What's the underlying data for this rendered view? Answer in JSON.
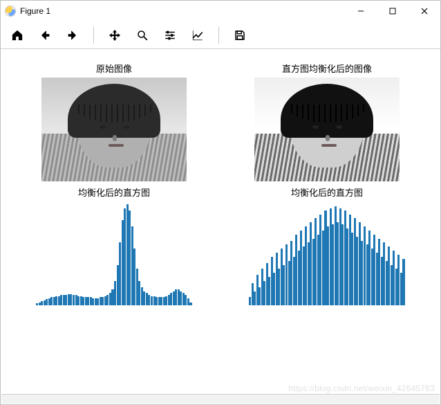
{
  "window": {
    "title": "Figure 1"
  },
  "toolbar": {
    "home": "Home",
    "back": "Back",
    "forward": "Forward",
    "pan": "Pan",
    "zoom": "Zoom",
    "configure": "Configure subplots",
    "edit": "Edit axis",
    "save": "Save"
  },
  "subplots": {
    "tl_title": "原始图像",
    "tr_title": "直方图均衡化后的图像",
    "bl_title": "均衡化后的直方图",
    "br_title": "均衡化后的直方图"
  },
  "chart_data": [
    {
      "type": "bar",
      "title": "均衡化后的直方图",
      "xlabel": "",
      "ylabel": "",
      "xlim": [
        0,
        255
      ],
      "ylim": [
        0,
        100
      ],
      "x_step": 4,
      "values": [
        2,
        3,
        4,
        5,
        6,
        7,
        8,
        8,
        9,
        9,
        10,
        10,
        10,
        11,
        11,
        10,
        10,
        9,
        9,
        8,
        8,
        8,
        8,
        7,
        7,
        7,
        8,
        8,
        9,
        10,
        12,
        16,
        24,
        40,
        62,
        84,
        96,
        100,
        94,
        78,
        56,
        36,
        24,
        18,
        14,
        12,
        10,
        9,
        9,
        8,
        8,
        8,
        8,
        9,
        10,
        12,
        14,
        16,
        16,
        14,
        12,
        10,
        7,
        3
      ]
    },
    {
      "type": "bar",
      "title": "均衡化后的直方图",
      "xlabel": "",
      "ylabel": "",
      "xlim": [
        0,
        255
      ],
      "ylim": [
        0,
        100
      ],
      "x_step": 4,
      "values": [
        8,
        22,
        14,
        30,
        18,
        36,
        24,
        42,
        28,
        48,
        32,
        52,
        36,
        56,
        40,
        60,
        44,
        64,
        48,
        70,
        54,
        74,
        58,
        78,
        62,
        82,
        66,
        86,
        70,
        90,
        74,
        94,
        78,
        96,
        80,
        98,
        82,
        96,
        80,
        94,
        76,
        90,
        72,
        86,
        68,
        82,
        64,
        78,
        60,
        74,
        56,
        70,
        52,
        66,
        48,
        62,
        44,
        58,
        40,
        54,
        36,
        50,
        32,
        46
      ]
    }
  ],
  "watermark": "https://blog.csdn.net/weixin_42645763"
}
